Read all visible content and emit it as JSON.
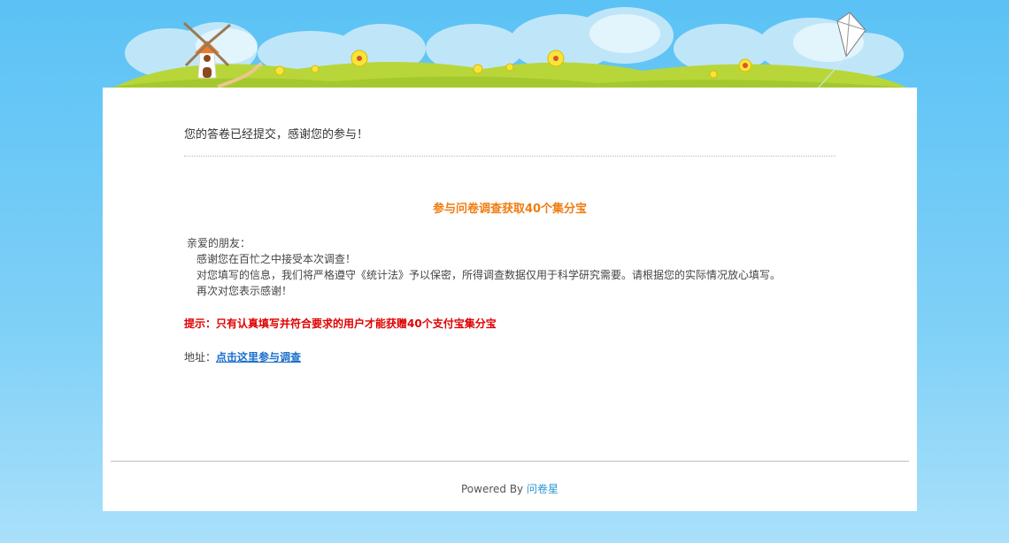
{
  "message": {
    "thanks": "您的答卷已经提交，感谢您的参与！"
  },
  "promo": {
    "headline": "参与问卷调查获取40个集分宝",
    "greeting": "亲爱的朋友：",
    "lines": [
      "感谢您在百忙之中接受本次调查！",
      "对您填写的信息，我们将严格遵守《统计法》予以保密，所得调查数据仅用于科学研究需要。请根据您的实际情况放心填写。",
      "再次对您表示感谢！"
    ],
    "tip": "提示：只有认真填写并符合要求的用户才能获赠40个支付宝集分宝",
    "address_label": "地址：",
    "address_link": "点击这里参与调查"
  },
  "footer": {
    "powered_by": "Powered By",
    "brand": "问卷星"
  },
  "colors": {
    "sky": "#5bc2f5",
    "headline": "#f07c10",
    "tip": "#e00000",
    "link": "#1a6fc9",
    "brand_link": "#2a96d6"
  }
}
